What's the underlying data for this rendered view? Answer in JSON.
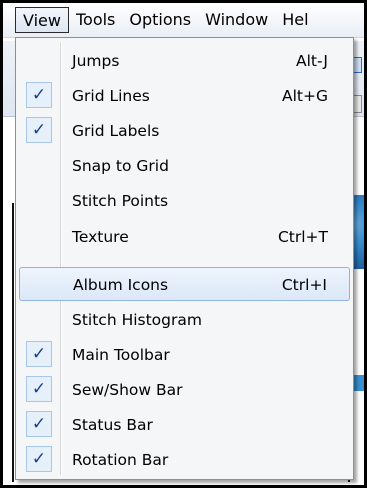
{
  "menubar": {
    "items": [
      {
        "label": "View",
        "active": true
      },
      {
        "label": "Tools"
      },
      {
        "label": "Options"
      },
      {
        "label": "Window"
      },
      {
        "label": "Hel"
      }
    ]
  },
  "view_menu": {
    "items": [
      {
        "label": "Jumps",
        "shortcut": "Alt-J",
        "checked": false
      },
      {
        "label": "Grid Lines",
        "shortcut": "Alt+G",
        "checked": true
      },
      {
        "label": "Grid Labels",
        "shortcut": "",
        "checked": true
      },
      {
        "label": "Snap to Grid",
        "shortcut": "",
        "checked": false
      },
      {
        "label": "Stitch Points",
        "shortcut": "",
        "checked": false
      },
      {
        "label": "Texture",
        "shortcut": "Ctrl+T",
        "checked": false
      },
      {
        "label": "Album Icons",
        "shortcut": "Ctrl+I",
        "checked": false,
        "highlighted": true
      },
      {
        "label": "Stitch Histogram",
        "shortcut": "",
        "checked": false
      },
      {
        "label": "Main Toolbar",
        "shortcut": "",
        "checked": true
      },
      {
        "label": "Sew/Show Bar",
        "shortcut": "",
        "checked": true
      },
      {
        "label": "Status Bar",
        "shortcut": "",
        "checked": true
      },
      {
        "label": "Rotation Bar",
        "shortcut": "",
        "checked": true
      }
    ]
  },
  "icons": {
    "check": "checkmark-icon",
    "check_glyph": "✓"
  },
  "colors": {
    "highlight_border": "#8eb3e0",
    "check_color": "#1a3f8a",
    "hoop_blue": "#3a8fd0"
  }
}
